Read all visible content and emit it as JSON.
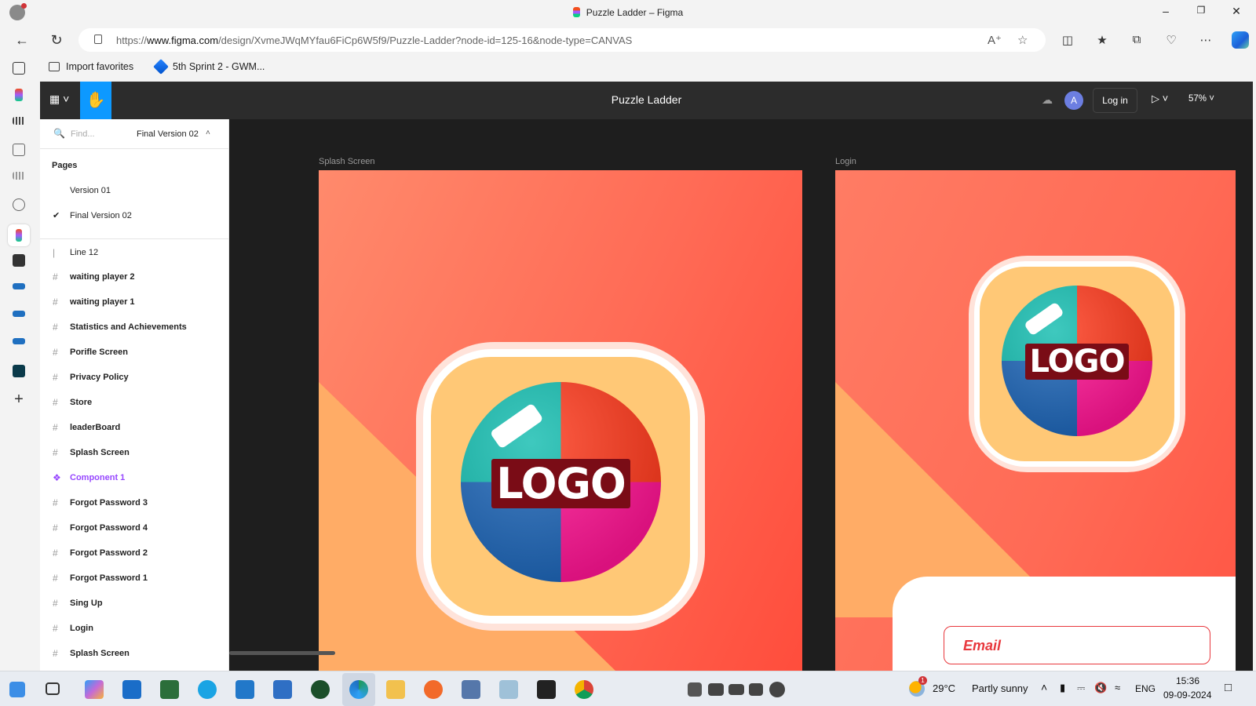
{
  "window": {
    "title": "Puzzle Ladder – Figma"
  },
  "browser": {
    "url_prefix": "https://",
    "url_domain": "www.figma.com",
    "url_path": "/design/XvmeJWqMYfau6FiCp6W5f9/Puzzle-Ladder?node-id=125-16&node-type=CANVAS",
    "favorites": [
      {
        "label": "Import favorites"
      },
      {
        "label": "5th Sprint 2 - GWM..."
      }
    ]
  },
  "figma": {
    "file_title": "Puzzle Ladder",
    "avatar_initial": "A",
    "login_label": "Log in",
    "zoom": "57%",
    "find_placeholder": "Find...",
    "current_page": "Final Version 02",
    "pages_heading": "Pages",
    "pages": [
      {
        "label": "Version 01",
        "selected": false
      },
      {
        "label": "Final Version 02",
        "selected": true
      }
    ],
    "layers": [
      {
        "label": "Line 12",
        "type": "line"
      },
      {
        "label": "waiting player 2",
        "type": "frame"
      },
      {
        "label": "waiting player 1",
        "type": "frame"
      },
      {
        "label": "Statistics and Achievements",
        "type": "frame"
      },
      {
        "label": "Porifle Screen",
        "type": "frame"
      },
      {
        "label": "Privacy Policy",
        "type": "frame"
      },
      {
        "label": "Store",
        "type": "frame"
      },
      {
        "label": "leaderBoard",
        "type": "frame"
      },
      {
        "label": "Splash Screen",
        "type": "frame"
      },
      {
        "label": "Component 1",
        "type": "component"
      },
      {
        "label": "Forgot Password 3",
        "type": "frame"
      },
      {
        "label": "Forgot Password 4",
        "type": "frame"
      },
      {
        "label": "Forgot Password 2",
        "type": "frame"
      },
      {
        "label": "Forgot Password 1",
        "type": "frame"
      },
      {
        "label": "Sing Up",
        "type": "frame"
      },
      {
        "label": "Login",
        "type": "frame"
      },
      {
        "label": "Splash Screen",
        "type": "frame"
      }
    ],
    "canvas": {
      "frames": [
        {
          "label": "Splash Screen",
          "logo_text": "LOGO"
        },
        {
          "label": "Login",
          "logo_text": "LOGO",
          "email_label": "Email"
        }
      ]
    },
    "accent_color": "#0d99ff",
    "component_color": "#9747ff"
  },
  "taskbar": {
    "weather_temp": "29°C",
    "weather_desc": "Partly sunny",
    "weather_badge": "1",
    "language": "ENG",
    "time": "15:36",
    "date": "09-09-2024"
  }
}
